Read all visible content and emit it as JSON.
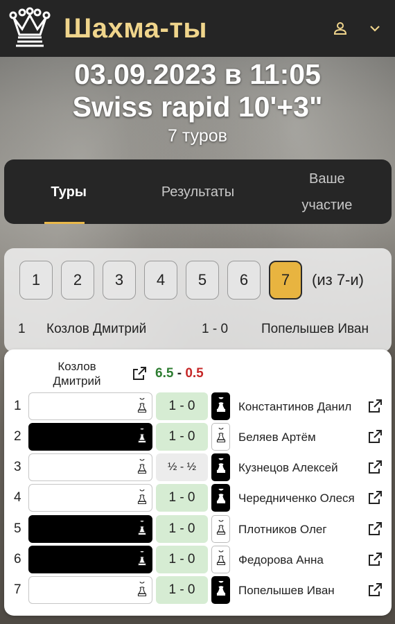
{
  "app": {
    "title": "Шахма-ты"
  },
  "header_icons": {
    "logo": "crown-logo",
    "user": "user-icon",
    "menu": "chevron-down-icon"
  },
  "event": {
    "date": "03.09.2023 в 11:05",
    "name": "Swiss rapid 10'+3\"",
    "rounds": "7 туров"
  },
  "tabs": [
    {
      "label": "Туры",
      "active": true
    },
    {
      "label": "Результаты",
      "active": false
    },
    {
      "label": "Ваше участие",
      "active": false
    }
  ],
  "round_selector": {
    "rounds": [
      "1",
      "2",
      "3",
      "4",
      "5",
      "6",
      "7"
    ],
    "selected": "7",
    "of_label": "(из 7-и)"
  },
  "pairing": {
    "board": "1",
    "white": "Козлов Дмитрий",
    "result": "1 - 0",
    "black": "Попелышев Иван"
  },
  "player_card": {
    "name": "Козлов Дмитрий",
    "score_win": "6.5",
    "score_sep": "-",
    "score_loss": "0.5",
    "games": [
      {
        "round": "1",
        "color": "white",
        "result": "1 - 0",
        "opponent": "Константинов Данил"
      },
      {
        "round": "2",
        "color": "black",
        "result": "1 - 0",
        "opponent": "Беляев Артём"
      },
      {
        "round": "3",
        "color": "white",
        "result": "½ - ½",
        "opponent": "Кузнецов Алексей"
      },
      {
        "round": "4",
        "color": "white",
        "result": "1 - 0",
        "opponent": "Чередниченко Олеся"
      },
      {
        "round": "5",
        "color": "black",
        "result": "1 - 0",
        "opponent": "Плотников Олег"
      },
      {
        "round": "6",
        "color": "black",
        "result": "1 - 0",
        "opponent": "Федорова Анна"
      },
      {
        "round": "7",
        "color": "white",
        "result": "1 - 0",
        "opponent": "Попелышев Иван"
      }
    ]
  },
  "colors": {
    "accent": "#e8b440",
    "title_gold": "#f0d58c",
    "win_green": "#2e7d32",
    "loss_red": "#c62828",
    "result_bg": "#d6ecd3"
  }
}
